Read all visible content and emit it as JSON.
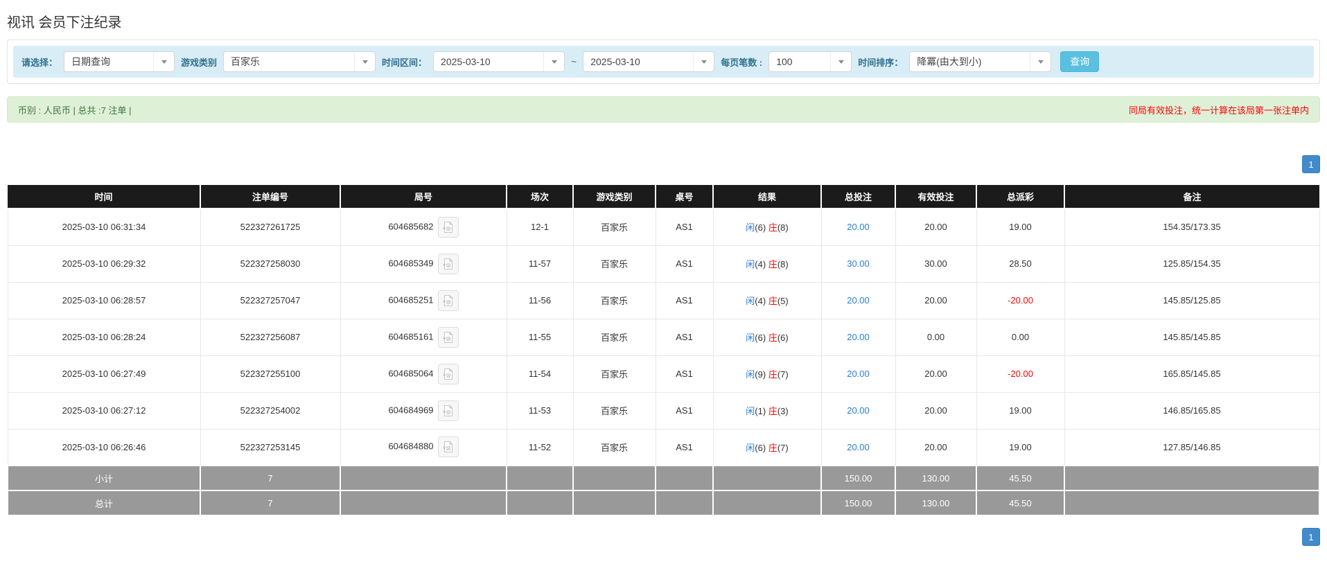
{
  "page": {
    "title": "视讯 会员下注纪录"
  },
  "filters": {
    "mode_label": "请选择：",
    "mode_value": "日期查询",
    "game_type_label": "游戏类别",
    "game_type_value": "百家乐",
    "time_range_label": "时间区间：",
    "date_from": "2025-03-10",
    "tilde": "~",
    "date_to": "2025-03-10",
    "page_size_label": "每页笔数 :",
    "page_size_value": "100",
    "sort_label": "时间排序：",
    "sort_value": "降冪(由大到小)",
    "query_button": "查询"
  },
  "summary": {
    "left": "币别 : 人民币 | 总共 :7 注单 |",
    "right": "同局有效投注，统一计算在该局第一张注单内"
  },
  "pagination": {
    "page": "1"
  },
  "icons": {
    "dropdown": "caret-down-icon",
    "round_video": "video-record-icon"
  },
  "colors": {
    "accent_blue": "#2a7cd6",
    "negative_red": "#ff0000",
    "header_bg": "#1b1b1b",
    "footer_bg": "#999999",
    "filter_bg": "#d9edf7",
    "summary_bg": "#dff0d8",
    "query_btn": "#5bc0de",
    "pager_btn": "#428bca"
  },
  "table": {
    "columns": [
      {
        "key": "time",
        "label": "时间"
      },
      {
        "key": "bet_id",
        "label": "注单编号"
      },
      {
        "key": "round_id",
        "label": "局号"
      },
      {
        "key": "session",
        "label": "场次"
      },
      {
        "key": "game",
        "label": "游戏类别"
      },
      {
        "key": "table_no",
        "label": "桌号"
      },
      {
        "key": "result",
        "label": "结果"
      },
      {
        "key": "total_bet",
        "label": "总投注"
      },
      {
        "key": "valid_bet",
        "label": "有效投注"
      },
      {
        "key": "payout",
        "label": "总派彩"
      },
      {
        "key": "note",
        "label": "备注"
      }
    ],
    "rows": [
      {
        "time": "2025-03-10 06:31:34",
        "bet_id": "522327261725",
        "round_id": "604685682",
        "session": "12-1",
        "game": "百家乐",
        "table_no": "AS1",
        "result": {
          "player_label": "闲",
          "player_score": "(6)",
          "banker_label": "庄",
          "banker_score": "(8)"
        },
        "total_bet": "20.00",
        "valid_bet": "20.00",
        "payout": "19.00",
        "note": "154.35/173.35"
      },
      {
        "time": "2025-03-10 06:29:32",
        "bet_id": "522327258030",
        "round_id": "604685349",
        "session": "11-57",
        "game": "百家乐",
        "table_no": "AS1",
        "result": {
          "player_label": "闲",
          "player_score": "(4)",
          "banker_label": "庄",
          "banker_score": "(8)"
        },
        "total_bet": "30.00",
        "valid_bet": "30.00",
        "payout": "28.50",
        "note": "125.85/154.35"
      },
      {
        "time": "2025-03-10 06:28:57",
        "bet_id": "522327257047",
        "round_id": "604685251",
        "session": "11-56",
        "game": "百家乐",
        "table_no": "AS1",
        "result": {
          "player_label": "闲",
          "player_score": "(4)",
          "banker_label": "庄",
          "banker_score": "(5)"
        },
        "total_bet": "20.00",
        "valid_bet": "20.00",
        "payout": "-20.00",
        "note": "145.85/125.85"
      },
      {
        "time": "2025-03-10 06:28:24",
        "bet_id": "522327256087",
        "round_id": "604685161",
        "session": "11-55",
        "game": "百家乐",
        "table_no": "AS1",
        "result": {
          "player_label": "闲",
          "player_score": "(6)",
          "banker_label": "庄",
          "banker_score": "(6)"
        },
        "total_bet": "20.00",
        "valid_bet": "0.00",
        "payout": "0.00",
        "note": "145.85/145.85"
      },
      {
        "time": "2025-03-10 06:27:49",
        "bet_id": "522327255100",
        "round_id": "604685064",
        "session": "11-54",
        "game": "百家乐",
        "table_no": "AS1",
        "result": {
          "player_label": "闲",
          "player_score": "(9)",
          "banker_label": "庄",
          "banker_score": "(7)"
        },
        "total_bet": "20.00",
        "valid_bet": "20.00",
        "payout": "-20.00",
        "note": "165.85/145.85"
      },
      {
        "time": "2025-03-10 06:27:12",
        "bet_id": "522327254002",
        "round_id": "604684969",
        "session": "11-53",
        "game": "百家乐",
        "table_no": "AS1",
        "result": {
          "player_label": "闲",
          "player_score": "(1)",
          "banker_label": "庄",
          "banker_score": "(3)"
        },
        "total_bet": "20.00",
        "valid_bet": "20.00",
        "payout": "19.00",
        "note": "146.85/165.85"
      },
      {
        "time": "2025-03-10 06:26:46",
        "bet_id": "522327253145",
        "round_id": "604684880",
        "session": "11-52",
        "game": "百家乐",
        "table_no": "AS1",
        "result": {
          "player_label": "闲",
          "player_score": "(6)",
          "banker_label": "庄",
          "banker_score": "(7)"
        },
        "total_bet": "20.00",
        "valid_bet": "20.00",
        "payout": "19.00",
        "note": "127.85/146.85"
      }
    ],
    "subtotal": {
      "label": "小计",
      "count": "7",
      "total_bet": "150.00",
      "valid_bet": "130.00",
      "payout": "45.50"
    },
    "total": {
      "label": "总计",
      "count": "7",
      "total_bet": "150.00",
      "valid_bet": "130.00",
      "payout": "45.50"
    }
  }
}
